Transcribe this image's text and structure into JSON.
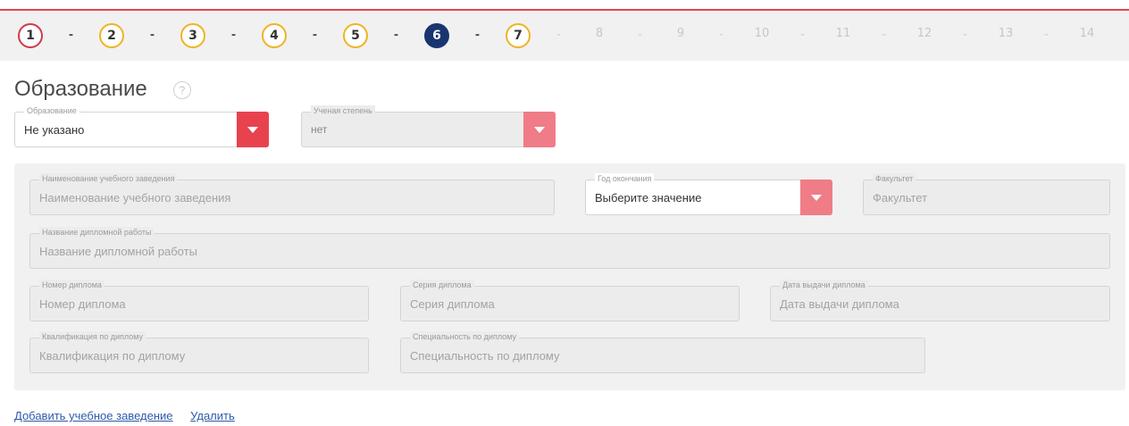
{
  "stepper": {
    "steps": [
      {
        "label": "1",
        "state": "first"
      },
      {
        "label": "2",
        "state": "done"
      },
      {
        "label": "3",
        "state": "done"
      },
      {
        "label": "4",
        "state": "done"
      },
      {
        "label": "5",
        "state": "done"
      },
      {
        "label": "6",
        "state": "current"
      },
      {
        "label": "7",
        "state": "done"
      },
      {
        "label": "8",
        "state": "future"
      },
      {
        "label": "9",
        "state": "future"
      },
      {
        "label": "10",
        "state": "future"
      },
      {
        "label": "11",
        "state": "future"
      },
      {
        "label": "12",
        "state": "future"
      },
      {
        "label": "13",
        "state": "future"
      },
      {
        "label": "14",
        "state": "future"
      }
    ],
    "separator": "-"
  },
  "page": {
    "title": "Образование",
    "help": "?"
  },
  "education": {
    "label": "Образование",
    "value": "Не указано"
  },
  "degree": {
    "label": "Ученая степень",
    "value": "нет"
  },
  "institution": {
    "name": {
      "label": "Наименование учебного заведения",
      "placeholder": "Наименование учебного заведения"
    },
    "year": {
      "label": "Год окончания",
      "value": "Выберите значение"
    },
    "faculty": {
      "label": "Факультет",
      "placeholder": "Факультет"
    },
    "thesis": {
      "label": "Название дипломной работы",
      "placeholder": "Название дипломной работы"
    },
    "diploma_number": {
      "label": "Номер диплома",
      "placeholder": "Номер диплома"
    },
    "diploma_series": {
      "label": "Серия диплома",
      "placeholder": "Серия диплома"
    },
    "diploma_date": {
      "label": "Дата выдачи диплома",
      "placeholder": "Дата выдачи диплома"
    },
    "qualification": {
      "label": "Квалификация по диплому",
      "placeholder": "Квалификация по диплому"
    },
    "specialty": {
      "label": "Специальность по диплому",
      "placeholder": "Специальность по диплому"
    }
  },
  "actions": {
    "add": "Добавить учебное заведение",
    "remove": "Удалить"
  },
  "colors": {
    "accent": "#e8424f",
    "current_step": "#1a3470",
    "done_step": "#f0b323"
  }
}
